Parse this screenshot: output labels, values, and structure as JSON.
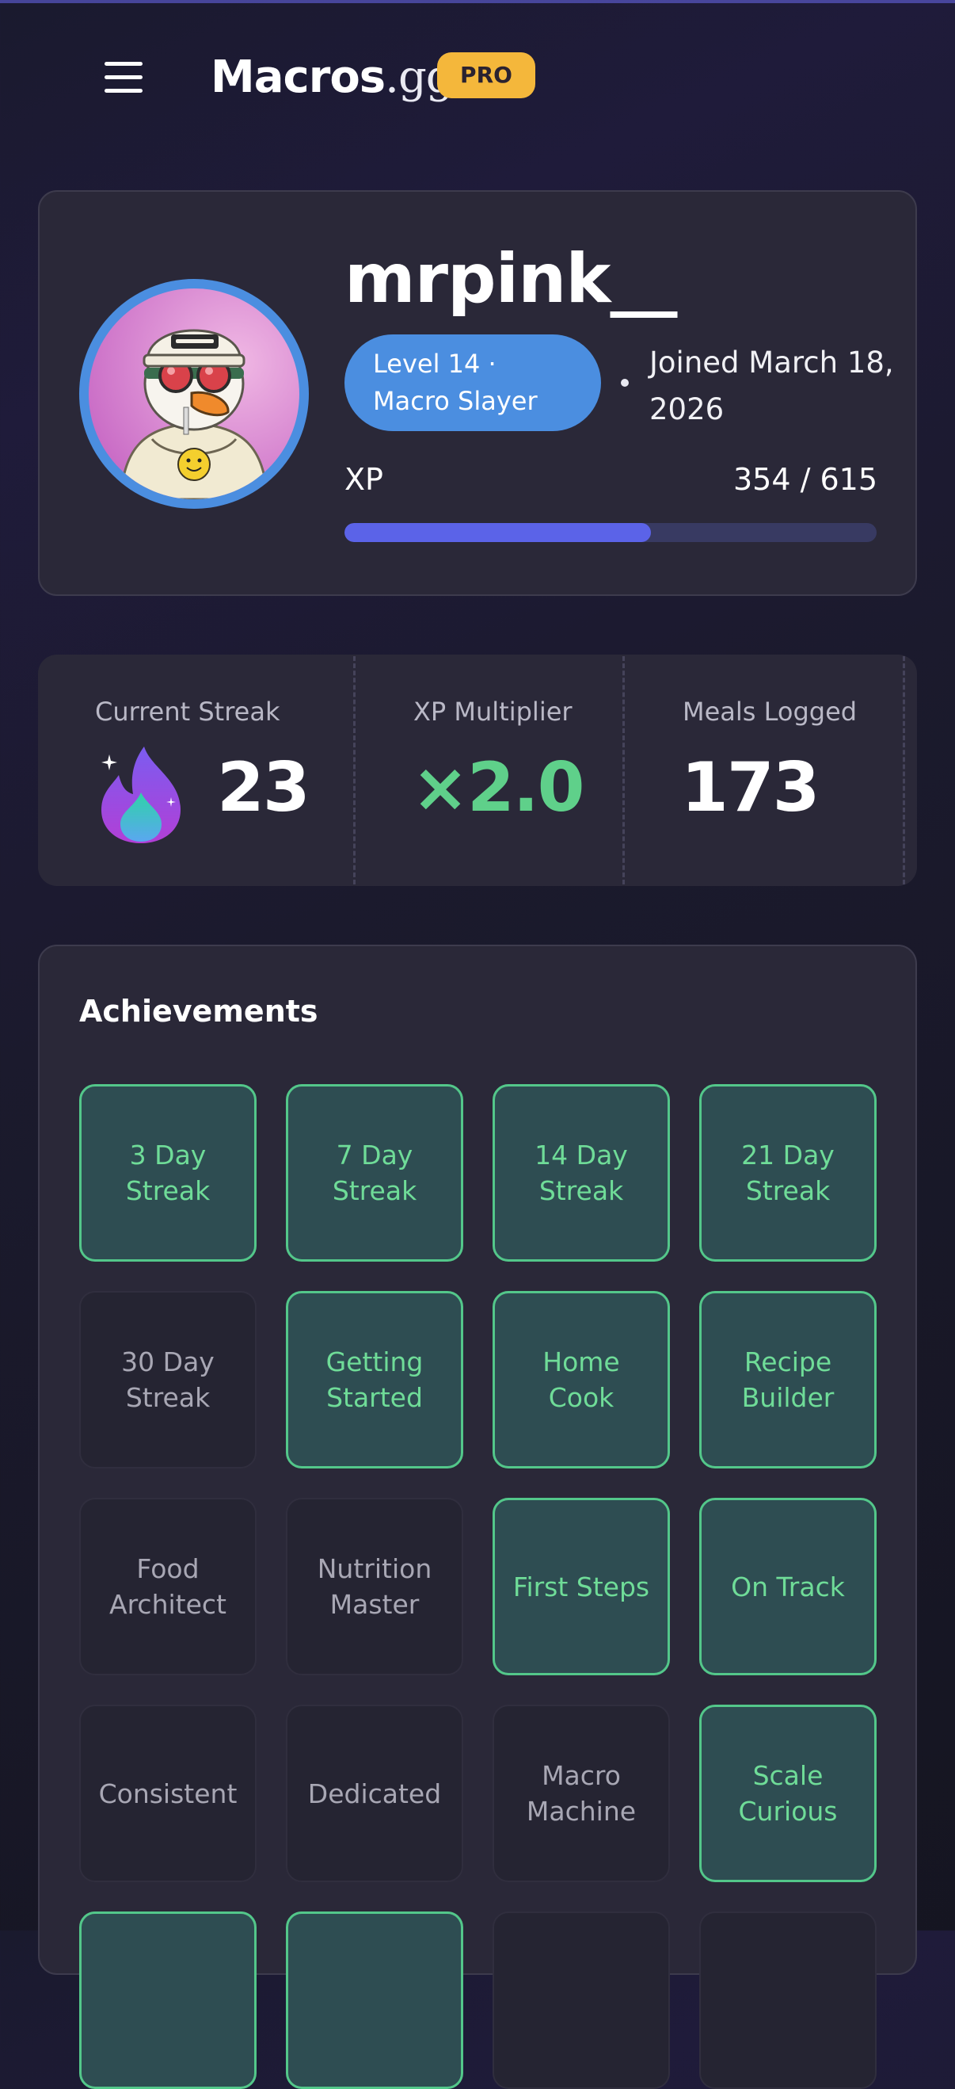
{
  "header": {
    "brand_bold": "Macros",
    "brand_light": ".gg",
    "badge": "PRO"
  },
  "profile": {
    "username": "mrpink__",
    "level_pill": "Level 14 · Macro Slayer",
    "joined": "Joined March 18, 2026",
    "xp_label": "XP",
    "xp_value": "354 / 615",
    "xp_progress": 0.576,
    "avatar_icon": "cartoon-duck-avatar-icon"
  },
  "stats": [
    {
      "label": "Current Streak",
      "value": "23",
      "icon": "flame-icon"
    },
    {
      "label": "XP Multiplier",
      "value": "×2.0"
    },
    {
      "label": "Meals Logged",
      "value": "173"
    }
  ],
  "achievements": {
    "title": "Achievements",
    "items": [
      {
        "label": "3 Day Streak",
        "unlocked": true
      },
      {
        "label": "7 Day Streak",
        "unlocked": true
      },
      {
        "label": "14 Day Streak",
        "unlocked": true
      },
      {
        "label": "21 Day Streak",
        "unlocked": true
      },
      {
        "label": "30 Day Streak",
        "unlocked": false
      },
      {
        "label": "Getting Started",
        "unlocked": true
      },
      {
        "label": "Home Cook",
        "unlocked": true
      },
      {
        "label": "Recipe Builder",
        "unlocked": true
      },
      {
        "label": "Food Architect",
        "unlocked": false
      },
      {
        "label": "Nutrition Master",
        "unlocked": false
      },
      {
        "label": "First Steps",
        "unlocked": true
      },
      {
        "label": "On Track",
        "unlocked": true
      },
      {
        "label": "Consistent",
        "unlocked": false
      },
      {
        "label": "Dedicated",
        "unlocked": false
      },
      {
        "label": "Macro Machine",
        "unlocked": false
      },
      {
        "label": "Scale Curious",
        "unlocked": true
      },
      {
        "label": "",
        "unlocked": true
      },
      {
        "label": "",
        "unlocked": true
      },
      {
        "label": "",
        "unlocked": false
      },
      {
        "label": "",
        "unlocked": false
      }
    ]
  },
  "colors": {
    "accent_blue": "#4b8ee0",
    "xp_fill": "#5b63e8",
    "unlocked_green": "#53c78a",
    "pro_badge": "#f4b73b"
  }
}
